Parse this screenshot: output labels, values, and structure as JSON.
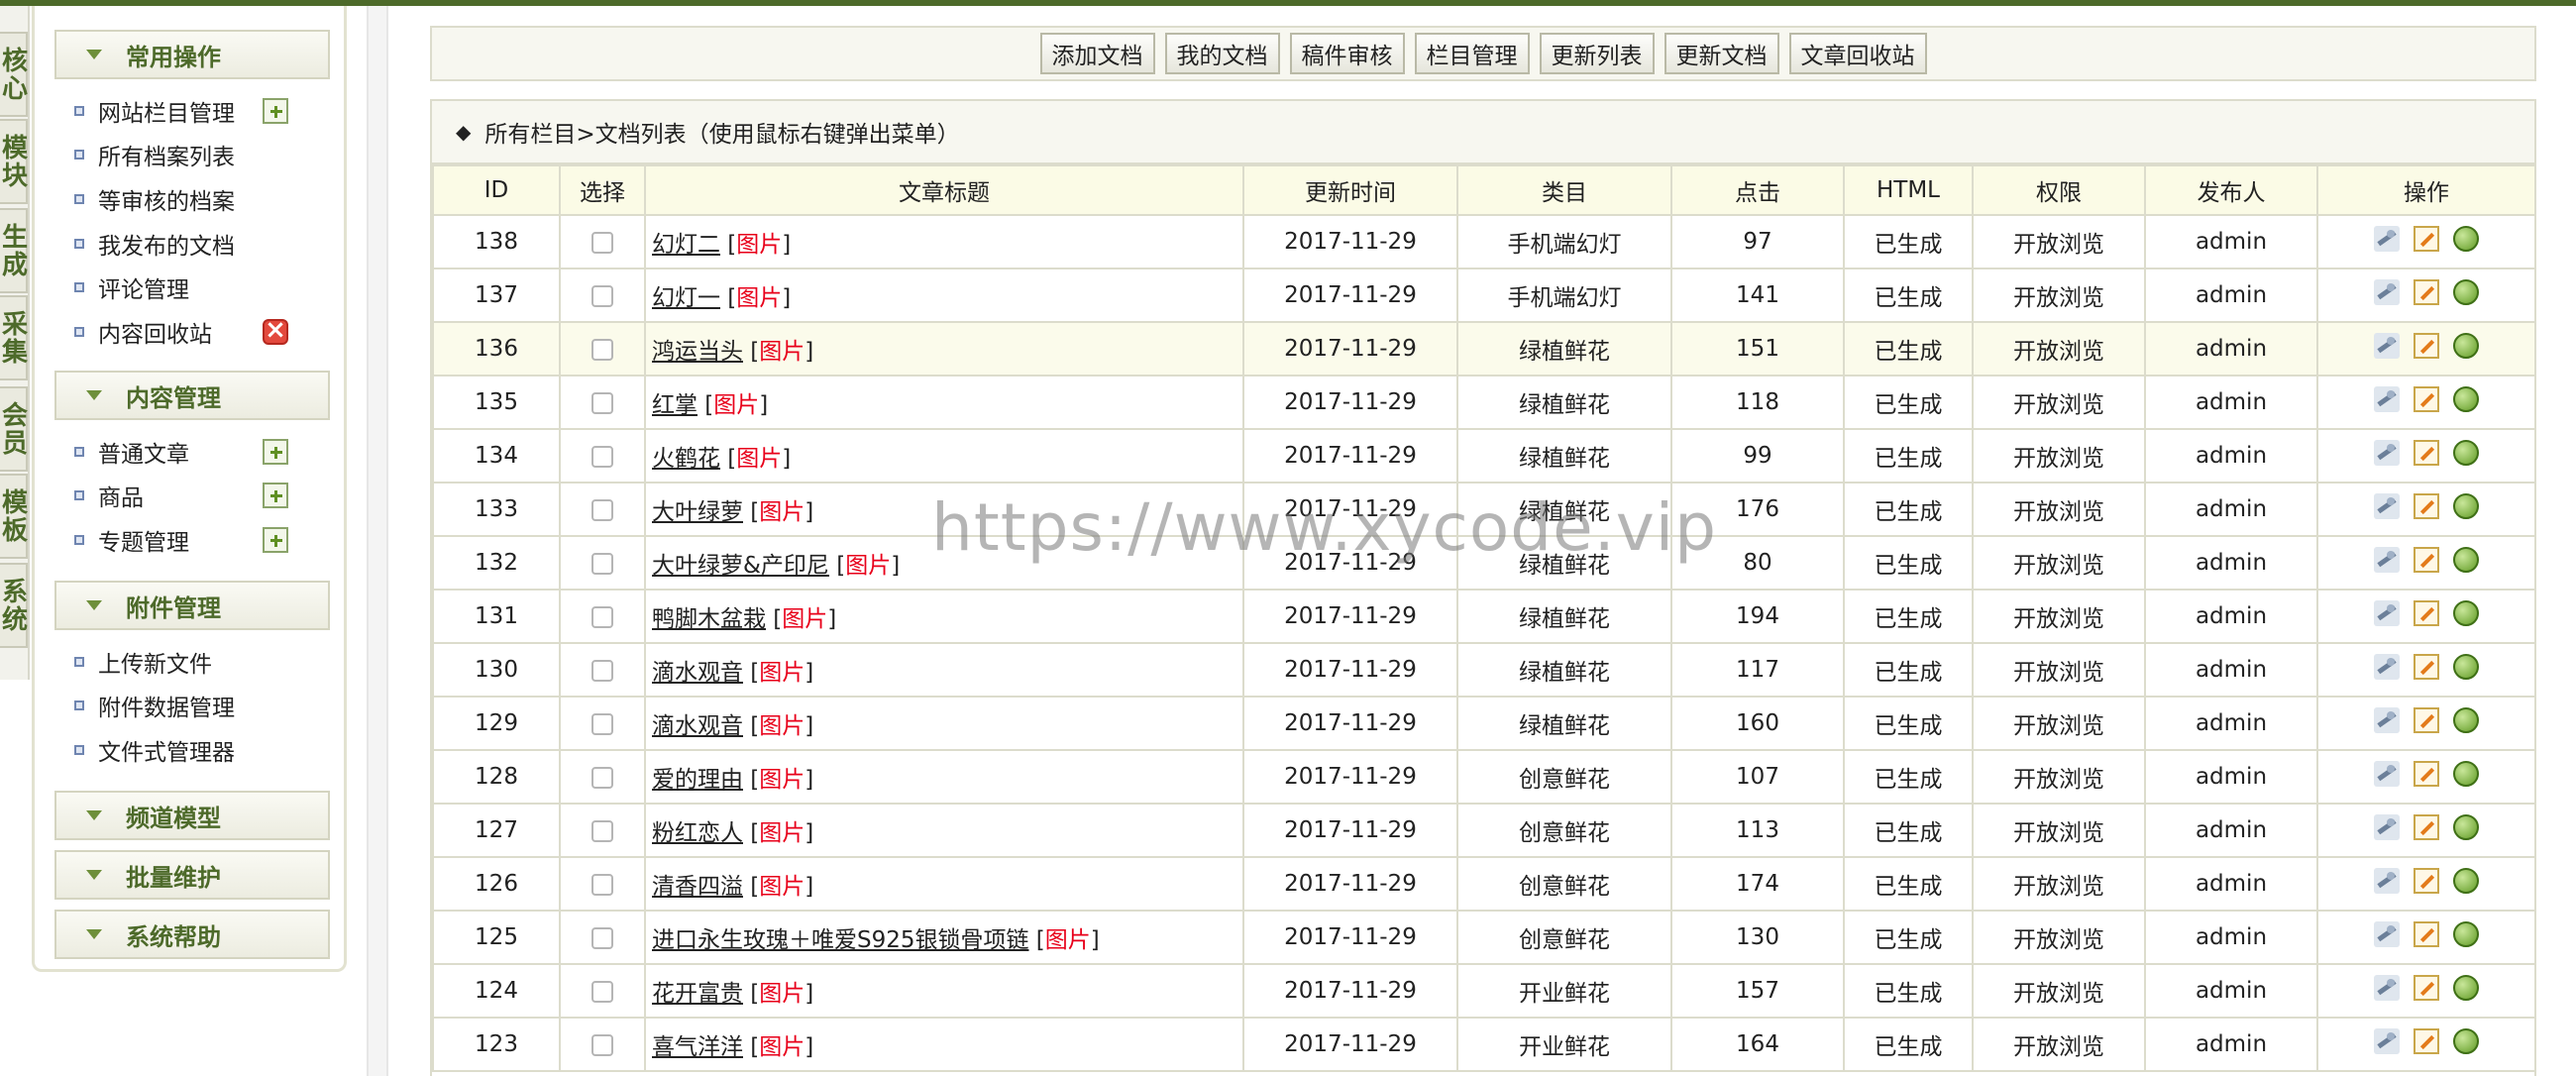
{
  "vertical_tabs": [
    "核心",
    "模块",
    "生成",
    "采集",
    "会员",
    "模板",
    "系统"
  ],
  "sidebar": {
    "sections": [
      {
        "title": "常用操作",
        "items": [
          {
            "label": "网站栏目管理",
            "action": "plus-icon"
          },
          {
            "label": "所有档案列表",
            "action": ""
          },
          {
            "label": "等审核的档案",
            "action": ""
          },
          {
            "label": "我发布的文档",
            "action": ""
          },
          {
            "label": "评论管理",
            "action": ""
          },
          {
            "label": "内容回收站",
            "action": "delete-icon"
          }
        ]
      },
      {
        "title": "内容管理",
        "items": [
          {
            "label": "普通文章",
            "action": "plus-icon"
          },
          {
            "label": "商品",
            "action": "plus-icon"
          },
          {
            "label": "专题管理",
            "action": "plus-icon"
          }
        ]
      },
      {
        "title": "附件管理",
        "items": [
          {
            "label": "上传新文件",
            "action": ""
          },
          {
            "label": "附件数据管理",
            "action": ""
          },
          {
            "label": "文件式管理器",
            "action": ""
          }
        ]
      },
      {
        "title": "频道模型",
        "items": []
      },
      {
        "title": "批量维护",
        "items": []
      },
      {
        "title": "系统帮助",
        "items": []
      }
    ]
  },
  "toolbar": {
    "buttons": [
      "添加文档",
      "我的文档",
      "稿件审核",
      "栏目管理",
      "更新列表",
      "更新文档",
      "文章回收站"
    ]
  },
  "breadcrumb": {
    "marker": "◆",
    "text": "所有栏目>文档列表（使用鼠标右键弹出菜单）"
  },
  "table": {
    "headers": [
      "ID",
      "选择",
      "文章标题",
      "更新时间",
      "类目",
      "点击",
      "HTML",
      "权限",
      "发布人",
      "操作"
    ],
    "pic_label": "图片",
    "rows": [
      {
        "id": "138",
        "title": "幻灯二",
        "time": "2017-11-29",
        "category": "手机端幻灯",
        "clicks": "97",
        "html": "已生成",
        "perm": "开放浏览",
        "author": "admin"
      },
      {
        "id": "137",
        "title": "幻灯一",
        "time": "2017-11-29",
        "category": "手机端幻灯",
        "clicks": "141",
        "html": "已生成",
        "perm": "开放浏览",
        "author": "admin"
      },
      {
        "id": "136",
        "title": "鸿运当头",
        "time": "2017-11-29",
        "category": "绿植鲜花",
        "clicks": "151",
        "html": "已生成",
        "perm": "开放浏览",
        "author": "admin"
      },
      {
        "id": "135",
        "title": "红掌",
        "time": "2017-11-29",
        "category": "绿植鲜花",
        "clicks": "118",
        "html": "已生成",
        "perm": "开放浏览",
        "author": "admin"
      },
      {
        "id": "134",
        "title": "火鹤花",
        "time": "2017-11-29",
        "category": "绿植鲜花",
        "clicks": "99",
        "html": "已生成",
        "perm": "开放浏览",
        "author": "admin"
      },
      {
        "id": "133",
        "title": "大叶绿萝",
        "time": "2017-11-29",
        "category": "绿植鲜花",
        "clicks": "176",
        "html": "已生成",
        "perm": "开放浏览",
        "author": "admin"
      },
      {
        "id": "132",
        "title": "大叶绿萝&产印尼",
        "time": "2017-11-29",
        "category": "绿植鲜花",
        "clicks": "80",
        "html": "已生成",
        "perm": "开放浏览",
        "author": "admin"
      },
      {
        "id": "131",
        "title": "鸭脚木盆栽",
        "time": "2017-11-29",
        "category": "绿植鲜花",
        "clicks": "194",
        "html": "已生成",
        "perm": "开放浏览",
        "author": "admin"
      },
      {
        "id": "130",
        "title": "滴水观音",
        "time": "2017-11-29",
        "category": "绿植鲜花",
        "clicks": "117",
        "html": "已生成",
        "perm": "开放浏览",
        "author": "admin"
      },
      {
        "id": "129",
        "title": "滴水观音",
        "time": "2017-11-29",
        "category": "绿植鲜花",
        "clicks": "160",
        "html": "已生成",
        "perm": "开放浏览",
        "author": "admin"
      },
      {
        "id": "128",
        "title": "爱的理由",
        "time": "2017-11-29",
        "category": "创意鲜花",
        "clicks": "107",
        "html": "已生成",
        "perm": "开放浏览",
        "author": "admin"
      },
      {
        "id": "127",
        "title": "粉红恋人",
        "time": "2017-11-29",
        "category": "创意鲜花",
        "clicks": "113",
        "html": "已生成",
        "perm": "开放浏览",
        "author": "admin"
      },
      {
        "id": "126",
        "title": "清香四溢",
        "time": "2017-11-29",
        "category": "创意鲜花",
        "clicks": "174",
        "html": "已生成",
        "perm": "开放浏览",
        "author": "admin"
      },
      {
        "id": "125",
        "title": "进口永生玫瑰＋唯爱S925银锁骨项链",
        "time": "2017-11-29",
        "category": "创意鲜花",
        "clicks": "130",
        "html": "已生成",
        "perm": "开放浏览",
        "author": "admin"
      },
      {
        "id": "124",
        "title": "花开富贵",
        "time": "2017-11-29",
        "category": "开业鲜花",
        "clicks": "157",
        "html": "已生成",
        "perm": "开放浏览",
        "author": "admin"
      },
      {
        "id": "123",
        "title": "喜气洋洋",
        "time": "2017-11-29",
        "category": "开业鲜花",
        "clicks": "164",
        "html": "已生成",
        "perm": "开放浏览",
        "author": "admin"
      }
    ],
    "highlighted_row_id": "136"
  },
  "watermark": "https://www.xycode.vip",
  "colors": {
    "accent": "#4d6a2a",
    "header_bg": "#fbfbe6",
    "pic_red": "#e8001a"
  }
}
